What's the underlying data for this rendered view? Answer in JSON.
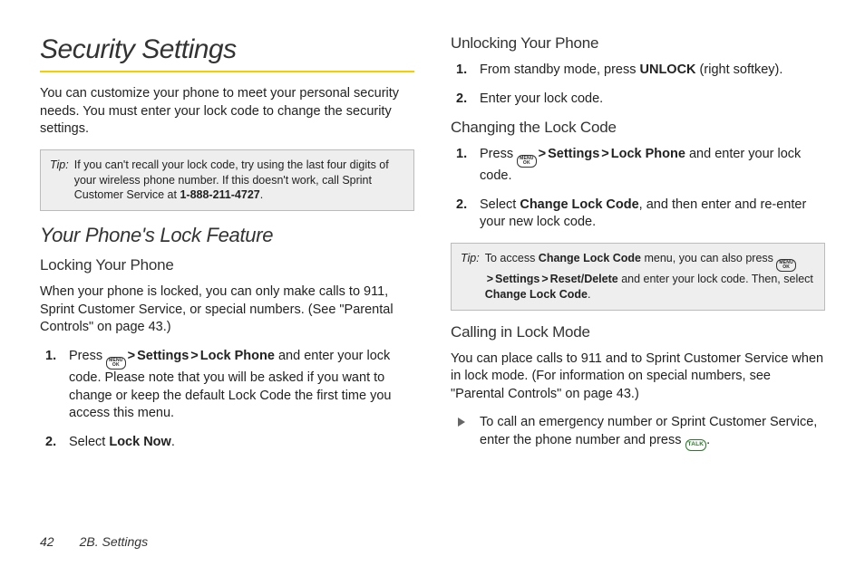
{
  "page": {
    "number": "42",
    "section_label": "2B. Settings"
  },
  "left": {
    "title": "Security Settings",
    "intro": "You can customize your phone to meet your personal security needs. You must enter your lock code to change the security settings.",
    "tip": {
      "label": "Tip:",
      "text_before": "If you can't recall your lock code, try using the last four digits of your wireless phone number. If this doesn't work, call Sprint Customer Service at ",
      "bold": "1-888-211-4727",
      "text_after": "."
    },
    "h2": "Your Phone's Lock Feature",
    "h3": "Locking Your Phone",
    "locking_intro": "When your phone is locked, you can only make calls to 911, Sprint Customer Service, or special numbers. (See \"Parental Controls\" on page 43.)",
    "step1": {
      "num": "1.",
      "pre": "Press ",
      "settings": "Settings",
      "lockphone": "Lock Phone",
      "post": " and enter your lock code. Please note that you will be asked if you want to change or keep the default Lock Code the first time you access this menu."
    },
    "step2": {
      "num": "2.",
      "pre": "Select ",
      "bold": "Lock Now",
      "post": "."
    }
  },
  "right": {
    "unlock_h3": "Unlocking Your Phone",
    "unlock_step1": {
      "num": "1.",
      "pre": "From standby mode, press ",
      "bold": "UNLOCK",
      "post": " (right softkey)."
    },
    "unlock_step2": {
      "num": "2.",
      "text": "Enter your lock code."
    },
    "change_h3": "Changing the Lock Code",
    "change_step1": {
      "num": "1.",
      "pre": "Press ",
      "settings": "Settings",
      "lockphone": "Lock Phone",
      "post": " and enter your lock code."
    },
    "change_step2": {
      "num": "2.",
      "pre": "Select ",
      "bold": "Change Lock Code",
      "post": ", and then enter and re-enter your new lock code."
    },
    "tip": {
      "label": "Tip:",
      "t1": "To access ",
      "b1": "Change Lock Code",
      "t2": " menu, you can also press ",
      "settings": "Settings",
      "reset": "Reset/Delete",
      "t3": " and enter your lock code. Then, select ",
      "b2": "Change Lock Code",
      "t4": "."
    },
    "calling_h3": "Calling in Lock Mode",
    "calling_intro": "You can place calls to 911 and to Sprint Customer Service when in lock mode. (For information on special numbers, see \"Parental Controls\" on page 43.)",
    "bullet": {
      "text": "To call an emergency number or Sprint Customer Service, enter the phone number and press ",
      "post": "."
    }
  },
  "icons": {
    "menu_top": "MENU",
    "menu_bottom": "OK",
    "talk": "TALK",
    "gt": ">"
  }
}
